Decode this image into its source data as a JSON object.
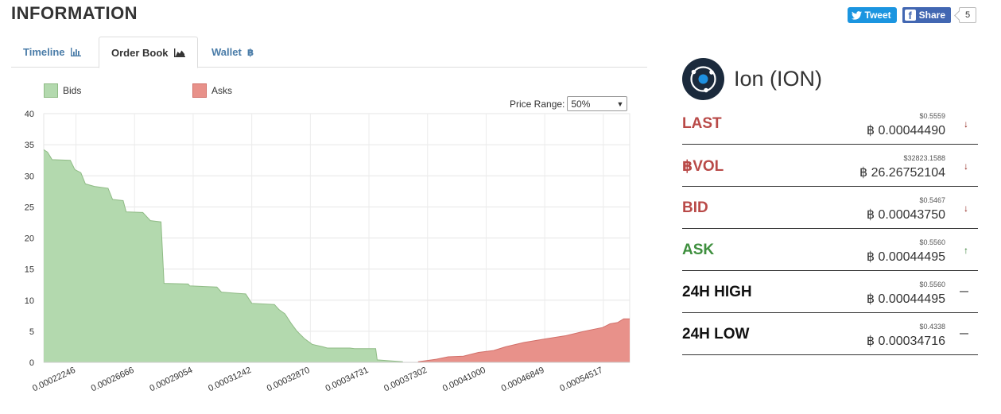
{
  "header": {
    "title": "INFORMATION"
  },
  "social": {
    "tweet_label": "Tweet",
    "share_label": "Share",
    "share_count": "5"
  },
  "tabs": [
    {
      "label": "Timeline",
      "icon": "bar-chart-icon",
      "glyph": "📊"
    },
    {
      "label": "Order Book",
      "icon": "area-chart-icon",
      "glyph": "◢"
    },
    {
      "label": "Wallet",
      "icon": "bitcoin-icon",
      "glyph": "฿"
    }
  ],
  "legend": {
    "bids": "Bids",
    "asks": "Asks"
  },
  "price_range": {
    "label": "Price Range:",
    "value": "50%"
  },
  "colors": {
    "bids_fill": "#b3d9ae",
    "bids_line": "#8fbb85",
    "asks_fill": "#e8918a",
    "asks_line": "#d2706a",
    "red": "#b94a48",
    "green": "#3e8f3e"
  },
  "coin": {
    "name": "Ion (ION)"
  },
  "stats": [
    {
      "label": "LAST",
      "usd": "$0.5559",
      "btc": "฿ 0.00044490",
      "trend": "down",
      "color": "#b94a48"
    },
    {
      "label": "฿VOL",
      "usd": "$32823.1588",
      "btc": "฿ 26.26752104",
      "trend": "down",
      "color": "#b94a48"
    },
    {
      "label": "BID",
      "usd": "$0.5467",
      "btc": "฿ 0.00043750",
      "trend": "down",
      "color": "#b94a48"
    },
    {
      "label": "ASK",
      "usd": "$0.5560",
      "btc": "฿ 0.00044495",
      "trend": "up",
      "color": "#3e8f3e"
    },
    {
      "label": "24H HIGH",
      "usd": "$0.5560",
      "btc": "฿ 0.00044495",
      "trend": "flat",
      "color": "#111111"
    },
    {
      "label": "24H LOW",
      "usd": "$0.4338",
      "btc": "฿ 0.00034716",
      "trend": "flat",
      "color": "#111111"
    }
  ],
  "chart_data": {
    "type": "area",
    "ylim": [
      0,
      40
    ],
    "yticks": [
      0,
      5,
      10,
      15,
      20,
      25,
      30,
      35,
      40
    ],
    "xlim": [
      0.00022246,
      0.00061
    ],
    "xticks": [
      "0.00022246",
      "0.00026666",
      "0.00029054",
      "0.00031242",
      "0.00032870",
      "0.00034731",
      "0.00037302",
      "0.00041000",
      "0.00046849",
      "0.00054517"
    ],
    "grid": true,
    "legend_position": "top-left",
    "series": [
      {
        "name": "Bids",
        "points": [
          [
            0.00022246,
            34.2
          ],
          [
            0.000225,
            33.8
          ],
          [
            0.000228,
            32.6
          ],
          [
            0.00024,
            32.5
          ],
          [
            0.000243,
            31.0
          ],
          [
            0.000247,
            30.5
          ],
          [
            0.00025,
            28.7
          ],
          [
            0.000256,
            28.3
          ],
          [
            0.000265,
            28.0
          ],
          [
            0.000268,
            26.2
          ],
          [
            0.000275,
            26.0
          ],
          [
            0.000277,
            24.2
          ],
          [
            0.000288,
            24.1
          ],
          [
            0.000293,
            22.8
          ],
          [
            0.0003,
            22.6
          ],
          [
            0.000302,
            12.7
          ],
          [
            0.000318,
            12.6
          ],
          [
            0.000319,
            12.3
          ],
          [
            0.000337,
            12.1
          ],
          [
            0.00034,
            11.3
          ],
          [
            0.00035,
            11.1
          ],
          [
            0.000356,
            11.0
          ],
          [
            0.00036,
            9.5
          ],
          [
            0.000375,
            9.3
          ],
          [
            0.000378,
            8.5
          ],
          [
            0.000382,
            7.8
          ],
          [
            0.000386,
            6.3
          ],
          [
            0.00039,
            5.0
          ],
          [
            0.000395,
            3.8
          ],
          [
            0.0004,
            2.9
          ],
          [
            0.000407,
            2.5
          ],
          [
            0.00041,
            2.3
          ],
          [
            0.000425,
            2.3
          ],
          [
            0.000428,
            2.2
          ],
          [
            0.000442,
            2.2
          ],
          [
            0.000443,
            0.4
          ],
          [
            0.00046,
            0.1
          ]
        ]
      },
      {
        "name": "Asks",
        "points": [
          [
            0.00047,
            0.1
          ],
          [
            0.000482,
            0.5
          ],
          [
            0.00049,
            0.9
          ],
          [
            0.0005,
            1.0
          ],
          [
            0.00051,
            1.6
          ],
          [
            0.00052,
            1.9
          ],
          [
            0.000528,
            2.5
          ],
          [
            0.00054,
            3.2
          ],
          [
            0.000555,
            3.8
          ],
          [
            0.000568,
            4.3
          ],
          [
            0.00058,
            5.0
          ],
          [
            0.000592,
            5.6
          ],
          [
            0.000597,
            6.2
          ],
          [
            0.000602,
            6.4
          ],
          [
            0.000606,
            7.0
          ],
          [
            0.00061,
            7.0
          ]
        ]
      }
    ]
  }
}
